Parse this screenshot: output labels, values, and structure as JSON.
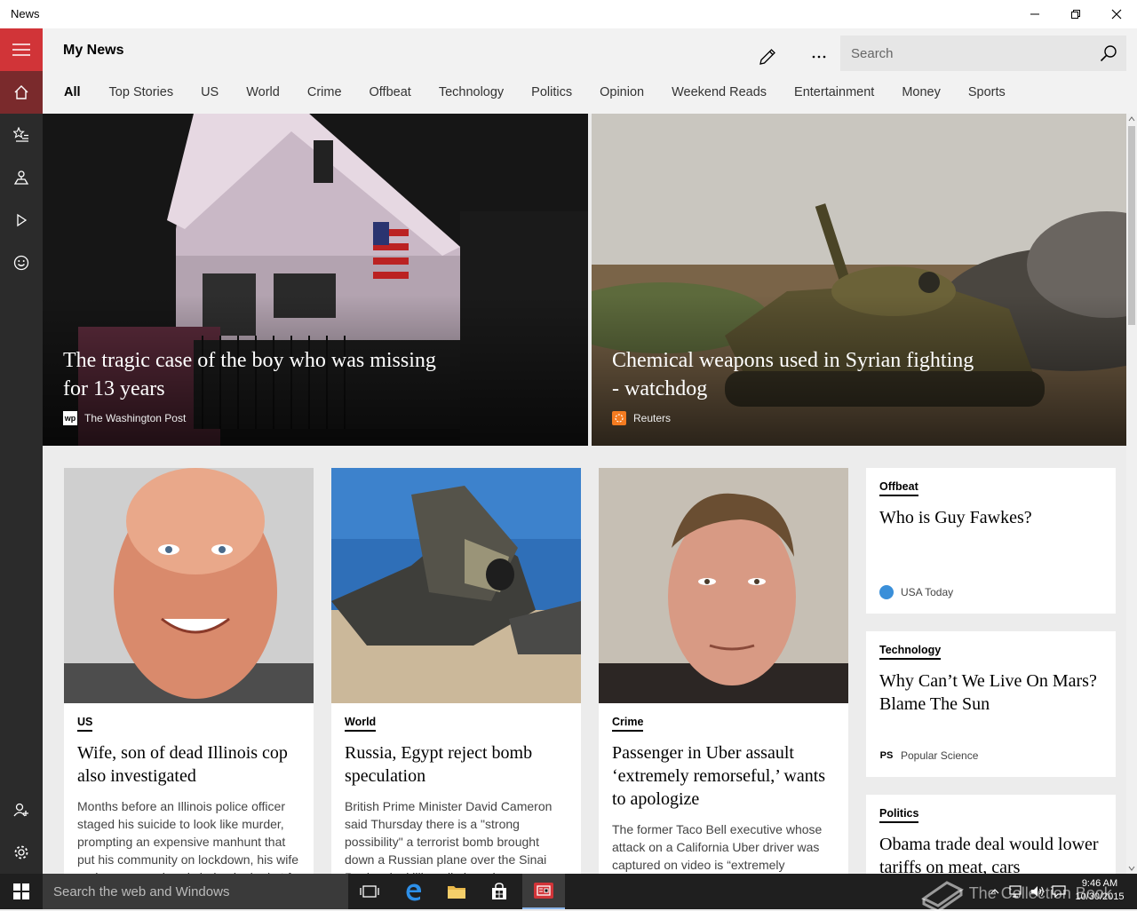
{
  "window": {
    "title": "News"
  },
  "header": {
    "title": "My News",
    "search_placeholder": "Search"
  },
  "tabs": [
    {
      "label": "All"
    },
    {
      "label": "Top Stories"
    },
    {
      "label": "US"
    },
    {
      "label": "World"
    },
    {
      "label": "Crime"
    },
    {
      "label": "Offbeat"
    },
    {
      "label": "Technology"
    },
    {
      "label": "Politics"
    },
    {
      "label": "Opinion"
    },
    {
      "label": "Weekend Reads"
    },
    {
      "label": "Entertainment"
    },
    {
      "label": "Money"
    },
    {
      "label": "Sports"
    }
  ],
  "heroes": [
    {
      "title": "The tragic case of the boy who was missing for 13 years",
      "source": "The Washington Post",
      "source_icon": "wp"
    },
    {
      "title": "Chemical weapons used in Syrian fighting - watchdog",
      "source": "Reuters"
    }
  ],
  "cards": [
    {
      "category": "US",
      "title": "Wife, son of dead Illinois cop also investigated",
      "summary": "Months before an Illinois police officer staged his suicide to look like murder, prompting an expensive manhunt that put his community on lockdown, his wife and son were already being looked at for financial misconduct."
    },
    {
      "category": "World",
      "title": "Russia, Egypt reject bomb speculation",
      "summary": "British Prime Minister David Cameron said Thursday there is a \"strong possibility\" a terrorist bomb brought down a Russian plane over the Sinai Peninsula, killing all aboard."
    },
    {
      "category": "Crime",
      "title": "Passenger in Uber assault ‘extremely remorseful,’ wants to apologize",
      "summary": "The former Taco Bell executive whose attack on a California Uber driver was captured on video is “extremely remorseful” and wants to apologize."
    }
  ],
  "side_cards": [
    {
      "category": "Offbeat",
      "title": "Who is Guy Fawkes?",
      "source": "USA Today"
    },
    {
      "category": "Technology",
      "title": "Why Can’t We Live On Mars? Blame The Sun",
      "source": "Popular Science",
      "source_icon": "PS"
    },
    {
      "category": "Politics",
      "title": "Obama trade deal would lower tariffs on meat, cars"
    }
  ],
  "taskbar": {
    "search_placeholder": "Search the web and Windows",
    "time": "9:46 AM",
    "date": "10/30/2015"
  },
  "watermark": "The Collection Book",
  "colors": {
    "accent": "#d13438",
    "rail": "#2b2b2b",
    "taskbar": "#1f1f1f"
  }
}
